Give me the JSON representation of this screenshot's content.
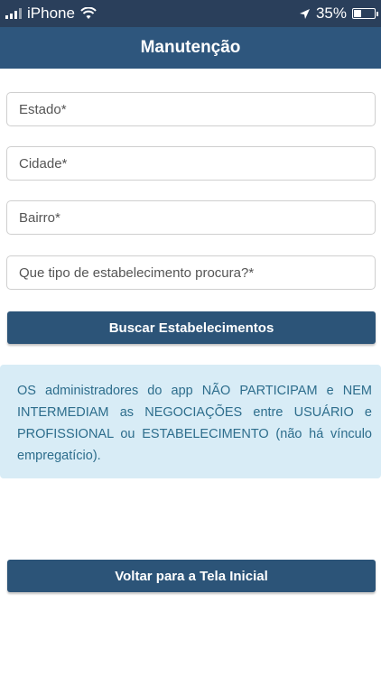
{
  "status_bar": {
    "carrier": "iPhone",
    "battery": "35%"
  },
  "header": {
    "title": "Manutenção"
  },
  "form": {
    "estado_placeholder": "Estado*",
    "cidade_placeholder": "Cidade*",
    "bairro_placeholder": "Bairro*",
    "tipo_placeholder": "Que tipo de estabelecimento procura?*"
  },
  "buttons": {
    "search_label": "Buscar Estabelecimentos",
    "back_label": "Voltar para a Tela Inicial"
  },
  "info": {
    "text": "OS administradores do app NÃO PARTICIPAM e NEM INTERMEDIAM as NEGOCIAÇÕES entre USUÁRIO e PROFISSIONAL ou ESTABELECIMENTO (não há vínculo empregatício)."
  }
}
